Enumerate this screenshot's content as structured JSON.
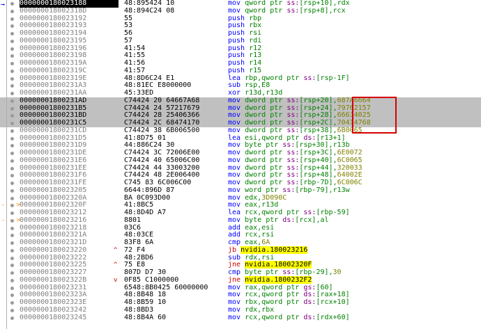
{
  "rows": [
    {
      "addr": "0000000180023188",
      "bytes": "48:895424 10",
      "mn": "mov",
      "ops": [
        [
          "reg",
          "qword ptr "
        ],
        [
          "seg",
          "ss:"
        ],
        [
          "reg",
          "["
        ],
        [
          "reg",
          "rsp+10"
        ],
        [
          "reg",
          "],"
        ],
        [
          "reg",
          "rdx"
        ]
      ],
      "cur": true
    },
    {
      "addr": "000000018002318D",
      "bytes": "48:894C24 08",
      "mn": "mov",
      "ops": [
        [
          "reg",
          "qword ptr "
        ],
        [
          "seg",
          "ss:"
        ],
        [
          "reg",
          "[rsp+8],rcx"
        ]
      ]
    },
    {
      "addr": "0000000180023192",
      "bytes": "55",
      "mn": "push",
      "ops": [
        [
          "reg",
          "rbp"
        ]
      ]
    },
    {
      "addr": "0000000180023193",
      "bytes": "53",
      "mn": "push",
      "ops": [
        [
          "reg",
          "rbx"
        ]
      ]
    },
    {
      "addr": "0000000180023194",
      "bytes": "56",
      "mn": "push",
      "ops": [
        [
          "reg",
          "rsi"
        ]
      ]
    },
    {
      "addr": "0000000180023195",
      "bytes": "57",
      "mn": "push",
      "ops": [
        [
          "reg",
          "rdi"
        ]
      ]
    },
    {
      "addr": "0000000180023196",
      "bytes": "41:54",
      "mn": "push",
      "ops": [
        [
          "reg",
          "r12"
        ]
      ]
    },
    {
      "addr": "0000000180023198",
      "bytes": "41:55",
      "mn": "push",
      "ops": [
        [
          "reg",
          "r13"
        ]
      ]
    },
    {
      "addr": "000000018002319A",
      "bytes": "41:56",
      "mn": "push",
      "ops": [
        [
          "reg",
          "r14"
        ]
      ]
    },
    {
      "addr": "000000018002319C",
      "bytes": "41:57",
      "mn": "push",
      "ops": [
        [
          "reg",
          "r15"
        ]
      ]
    },
    {
      "addr": "000000018002319E",
      "bytes": "48:8D6C24 E1",
      "mn": "lea",
      "ops": [
        [
          "reg",
          "rbp,qword ptr "
        ],
        [
          "seg",
          "ss:"
        ],
        [
          "reg",
          "[rsp-1F]"
        ]
      ]
    },
    {
      "addr": "00000001800231A3",
      "bytes": "48:81EC E8000000",
      "mn": "sub",
      "ops": [
        [
          "reg",
          "rsp,E8"
        ]
      ]
    },
    {
      "addr": "00000001800231AA",
      "bytes": "45:33ED",
      "mn": "xor",
      "ops": [
        [
          "reg",
          "r13d,r13d"
        ]
      ]
    },
    {
      "addr": "00000001800231AD",
      "bytes": "C74424 20 64667A68",
      "mn": "mov",
      "ops": [
        [
          "reg",
          "dword ptr "
        ],
        [
          "seg",
          "ss:"
        ],
        [
          "reg",
          "[rsp+20],"
        ],
        [
          "num",
          "687A6664"
        ]
      ],
      "sel": true
    },
    {
      "addr": "00000001800231B5",
      "bytes": "C74424 24 57217679",
      "mn": "mov",
      "ops": [
        [
          "reg",
          "dword ptr "
        ],
        [
          "seg",
          "ss:"
        ],
        [
          "reg",
          "[rsp+24],"
        ],
        [
          "num",
          "79762157"
        ]
      ],
      "sel": true
    },
    {
      "addr": "00000001800231BD",
      "bytes": "C74424 28 25406366",
      "mn": "mov",
      "ops": [
        [
          "reg",
          "dword ptr "
        ],
        [
          "seg",
          "ss:"
        ],
        [
          "reg",
          "[rsp+28],"
        ],
        [
          "num",
          "66634025"
        ]
      ],
      "sel": true
    },
    {
      "addr": "00000001800231C5",
      "bytes": "C74424 2C 68474170",
      "mn": "mov",
      "ops": [
        [
          "reg",
          "dword ptr "
        ],
        [
          "seg",
          "ss:"
        ],
        [
          "reg",
          "[rsp+2C],"
        ],
        [
          "num",
          "70414768"
        ]
      ],
      "sel": true
    },
    {
      "addr": "00000001800231CD",
      "bytes": "C74424 38 6B006500",
      "mn": "mov",
      "ops": [
        [
          "reg",
          "dword ptr "
        ],
        [
          "seg",
          "ss:"
        ],
        [
          "reg",
          "[rsp+38],"
        ],
        [
          "num",
          "6B0065"
        ]
      ]
    },
    {
      "addr": "00000001800231D5",
      "bytes": "41:8D75 01",
      "mn": "lea",
      "ops": [
        [
          "reg",
          "esi,qword ptr "
        ],
        [
          "seg",
          "ds:"
        ],
        [
          "reg",
          "[r13+1]"
        ]
      ]
    },
    {
      "addr": "00000001800231D9",
      "bytes": "44:886C24 30",
      "mn": "mov",
      "ops": [
        [
          "reg",
          "byte ptr "
        ],
        [
          "seg",
          "ss:"
        ],
        [
          "reg",
          "[rsp+30],r13b"
        ]
      ]
    },
    {
      "addr": "00000001800231DE",
      "bytes": "C74424 3C 72006E00",
      "mn": "mov",
      "ops": [
        [
          "reg",
          "dword ptr "
        ],
        [
          "seg",
          "ss:"
        ],
        [
          "reg",
          "[rsp+3C],"
        ],
        [
          "num",
          "6E0072"
        ]
      ]
    },
    {
      "addr": "00000001800231E6",
      "bytes": "C74424 40 65006C00",
      "mn": "mov",
      "ops": [
        [
          "reg",
          "dword ptr "
        ],
        [
          "seg",
          "ss:"
        ],
        [
          "reg",
          "[rsp+40],"
        ],
        [
          "num",
          "6C0065"
        ]
      ]
    },
    {
      "addr": "00000001800231EE",
      "bytes": "C74424 44 33003200",
      "mn": "mov",
      "ops": [
        [
          "reg",
          "dword ptr "
        ],
        [
          "seg",
          "ss:"
        ],
        [
          "reg",
          "[rsp+44],"
        ],
        [
          "num",
          "320033"
        ]
      ]
    },
    {
      "addr": "00000001800231F6",
      "bytes": "C74424 48 2E006400",
      "mn": "mov",
      "ops": [
        [
          "reg",
          "dword ptr "
        ],
        [
          "seg",
          "ss:"
        ],
        [
          "reg",
          "[rsp+48],"
        ],
        [
          "num",
          "64002E"
        ]
      ]
    },
    {
      "addr": "00000001800231FE",
      "bytes": "C745 83 6C006C00",
      "mn": "mov",
      "ops": [
        [
          "reg",
          "dword ptr "
        ],
        [
          "seg",
          "ss:"
        ],
        [
          "reg",
          "[rbp-7D],"
        ],
        [
          "num",
          "6C006C"
        ]
      ]
    },
    {
      "addr": "0000000180023205",
      "bytes": "6644:896D 87",
      "mn": "mov",
      "ops": [
        [
          "reg",
          "word ptr "
        ],
        [
          "seg",
          "ss:"
        ],
        [
          "reg",
          "[rbp-79],r13w"
        ]
      ]
    },
    {
      "addr": "000000018002320A",
      "bytes": "BA 0C093D00",
      "mn": "mov",
      "ops": [
        [
          "reg",
          "edx,"
        ],
        [
          "num",
          "3D090C"
        ]
      ]
    },
    {
      "addr": "000000018002320F",
      "bytes": "41:8BC5",
      "mn": "mov",
      "ops": [
        [
          "reg",
          "eax,r13d"
        ]
      ],
      "ret": true
    },
    {
      "addr": "0000000180023212",
      "bytes": "48:8D4D A7",
      "mn": "lea",
      "ops": [
        [
          "reg",
          "rcx,qword ptr "
        ],
        [
          "seg",
          "ss:"
        ],
        [
          "reg",
          "[rbp-59]"
        ]
      ]
    },
    {
      "addr": "0000000180023216",
      "bytes": "8801",
      "mn": "mov",
      "ops": [
        [
          "reg",
          "byte ptr "
        ],
        [
          "seg",
          "ds:"
        ],
        [
          "reg",
          "[rcx],al"
        ]
      ],
      "ret": true
    },
    {
      "addr": "0000000180023218",
      "bytes": "03C6",
      "mn": "add",
      "ops": [
        [
          "reg",
          "eax,esi"
        ]
      ]
    },
    {
      "addr": "000000018002321A",
      "bytes": "48:03CE",
      "mn": "add",
      "ops": [
        [
          "reg",
          "rcx,rsi"
        ]
      ]
    },
    {
      "addr": "000000018002321D",
      "bytes": "83F8 6A",
      "mn": "cmp",
      "ops": [
        [
          "reg",
          "eax,"
        ],
        [
          "num",
          "6A"
        ]
      ]
    },
    {
      "addr": "0000000180023220",
      "bytes": "72 F4",
      "mn": "jb",
      "jmark": "^",
      "ops": [
        [
          "call",
          "nvidia.180023216"
        ]
      ]
    },
    {
      "addr": "0000000180023222",
      "bytes": "48:2BD6",
      "mn": "sub",
      "ops": [
        [
          "reg",
          "rdx,rsi"
        ]
      ]
    },
    {
      "addr": "0000000180023225",
      "bytes": "75 E8",
      "mn": "jne",
      "jmark": "^",
      "ops": [
        [
          "call",
          "nvidia.18002320F"
        ]
      ]
    },
    {
      "addr": "0000000180023227",
      "bytes": "807D D7 30",
      "mn": "cmp",
      "ops": [
        [
          "reg",
          "byte ptr "
        ],
        [
          "seg",
          "ss:"
        ],
        [
          "reg",
          "[rbp-29],"
        ],
        [
          "num",
          "30"
        ]
      ]
    },
    {
      "addr": "000000018002322B",
      "bytes": "0F85 C1000000",
      "mn": "jne",
      "jmark": "v",
      "ops": [
        [
          "call",
          "nvidia.1800232F2"
        ]
      ]
    },
    {
      "addr": "0000000180023231",
      "bytes": "6548:8B0425 60000000",
      "mn": "mov",
      "ops": [
        [
          "reg",
          "rax,qword ptr "
        ],
        [
          "seg",
          "gs:"
        ],
        [
          "reg",
          "[60]"
        ]
      ]
    },
    {
      "addr": "000000018002323A",
      "bytes": "48:8B48 18",
      "mn": "mov",
      "ops": [
        [
          "reg",
          "rcx,qword ptr "
        ],
        [
          "seg",
          "ds:"
        ],
        [
          "reg",
          "[rax+18]"
        ]
      ]
    },
    {
      "addr": "000000018002323E",
      "bytes": "48:8B59 10",
      "mn": "mov",
      "ops": [
        [
          "reg",
          "rbx,qword ptr "
        ],
        [
          "seg",
          "ds:"
        ],
        [
          "reg",
          "[rcx+10]"
        ]
      ]
    },
    {
      "addr": "0000000180023242",
      "bytes": "48:8BD3",
      "mn": "mov",
      "ops": [
        [
          "reg",
          "rdx,rbx"
        ]
      ]
    },
    {
      "addr": "0000000180023245",
      "bytes": "48:8B4A 60",
      "mn": "mov",
      "ops": [
        [
          "reg",
          "rcx,qword ptr "
        ],
        [
          "seg",
          "ds:"
        ],
        [
          "reg",
          "[rdx+60]"
        ]
      ]
    }
  ],
  "colors": {
    "selected": "#c0c0c0",
    "highlight_box": "#d40000",
    "keyword": "#0000ff"
  }
}
